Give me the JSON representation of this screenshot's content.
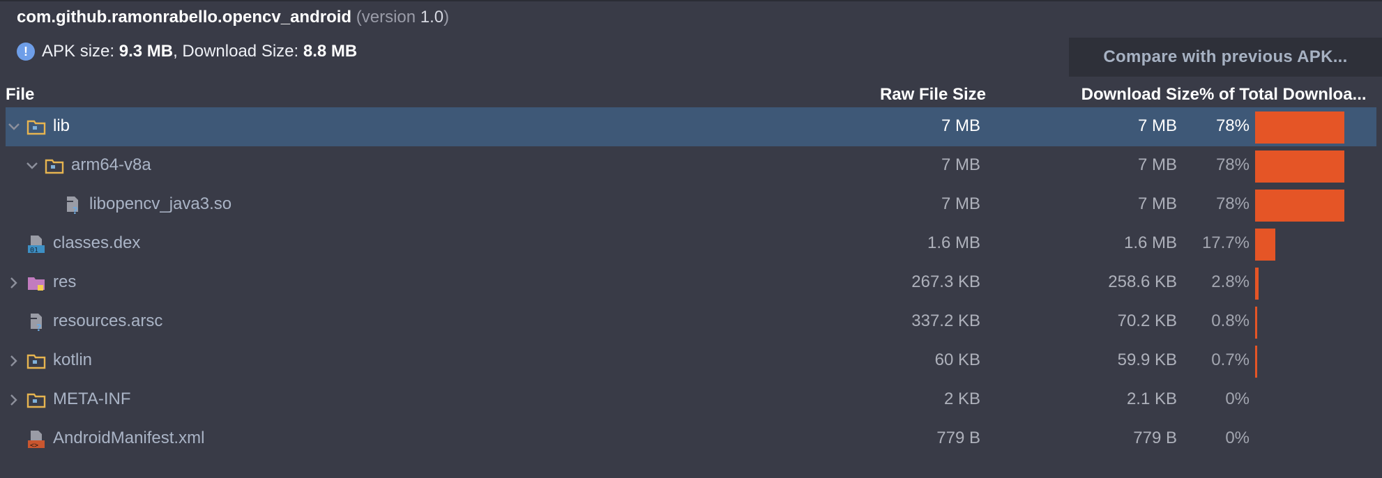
{
  "package": {
    "name": "com.github.ramonrabello.opencv_android",
    "version_prefix": "(version ",
    "version": "1.0",
    "version_suffix": ")"
  },
  "summary": {
    "apk_label": "APK size: ",
    "apk_value": "9.3 MB",
    "sep": ", Download Size: ",
    "dl_value": "8.8 MB"
  },
  "compare_button": "Compare with previous APK...",
  "columns": {
    "file": "File",
    "raw": "Raw File Size",
    "download": "Download Size",
    "percent": "% of Total Downloa..."
  },
  "rows": [
    {
      "name": "lib",
      "raw": "7 MB",
      "download": "7 MB",
      "percent": "78%",
      "fraction": 0.78,
      "icon": "folder-icon",
      "expand": "expanded"
    },
    {
      "name": "arm64-v8a",
      "raw": "7 MB",
      "download": "7 MB",
      "percent": "78%",
      "fraction": 0.78,
      "icon": "folder-icon",
      "expand": "expanded"
    },
    {
      "name": "libopencv_java3.so",
      "raw": "7 MB",
      "download": "7 MB",
      "percent": "78%",
      "fraction": 0.78,
      "icon": "unknown-file-icon",
      "expand": "none"
    },
    {
      "name": "classes.dex",
      "raw": "1.6 MB",
      "download": "1.6 MB",
      "percent": "17.7%",
      "fraction": 0.177,
      "icon": "dex-file-icon",
      "expand": "none"
    },
    {
      "name": "res",
      "raw": "267.3 KB",
      "download": "258.6 KB",
      "percent": "2.8%",
      "fraction": 0.028,
      "icon": "resource-folder-icon",
      "expand": "collapsed"
    },
    {
      "name": "resources.arsc",
      "raw": "337.2 KB",
      "download": "70.2 KB",
      "percent": "0.8%",
      "fraction": 0.008,
      "icon": "unknown-file-icon",
      "expand": "none"
    },
    {
      "name": "kotlin",
      "raw": "60 KB",
      "download": "59.9 KB",
      "percent": "0.7%",
      "fraction": 0.007,
      "icon": "folder-icon",
      "expand": "collapsed"
    },
    {
      "name": "META-INF",
      "raw": "2 KB",
      "download": "2.1 KB",
      "percent": "0%",
      "fraction": 0,
      "icon": "folder-icon",
      "expand": "collapsed"
    },
    {
      "name": "AndroidManifest.xml",
      "raw": "779 B",
      "download": "779 B",
      "percent": "0%",
      "fraction": 0,
      "icon": "xml-file-icon",
      "expand": "none"
    }
  ],
  "colors": {
    "background": "#393b47",
    "selection": "#3e5877",
    "bar": "#e55526",
    "folder": "#e6b450",
    "res_folder": "#c27bbf"
  }
}
